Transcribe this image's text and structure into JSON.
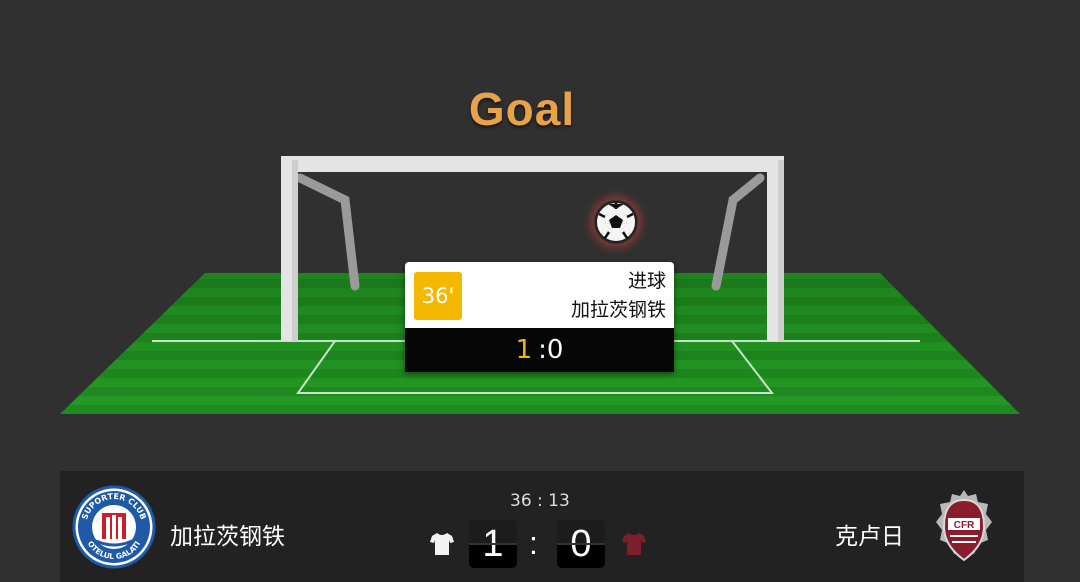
{
  "animation": {
    "title": "Goal"
  },
  "event_card": {
    "minute": "36'",
    "event_type": "进球",
    "team": "加拉茨钢铁",
    "home_score": "1",
    "score_separator": ":",
    "away_score": "0"
  },
  "scoreboard": {
    "match_clock": "36 : 13",
    "home_team": {
      "name": "加拉茨钢铁",
      "logo_icon": "otelul-galati-crest",
      "shirt_icon": "white-shirt-icon",
      "shirt_color": "#f2f2f2",
      "score": "1",
      "logo_text_top": "SUPORTER CLUB",
      "logo_text_bottom": "OTELUL GALATI"
    },
    "away_team": {
      "name": "克卢日",
      "logo_icon": "cfr-cluj-crest",
      "shirt_icon": "maroon-shirt-icon",
      "shirt_color": "#7a1f2b",
      "score": "0",
      "logo_text": "CFR"
    },
    "separator": ":"
  },
  "colors": {
    "accent": "#f5b800",
    "title": "#e8a24a",
    "pitch": "#1f8a1f",
    "background": "#303030"
  }
}
